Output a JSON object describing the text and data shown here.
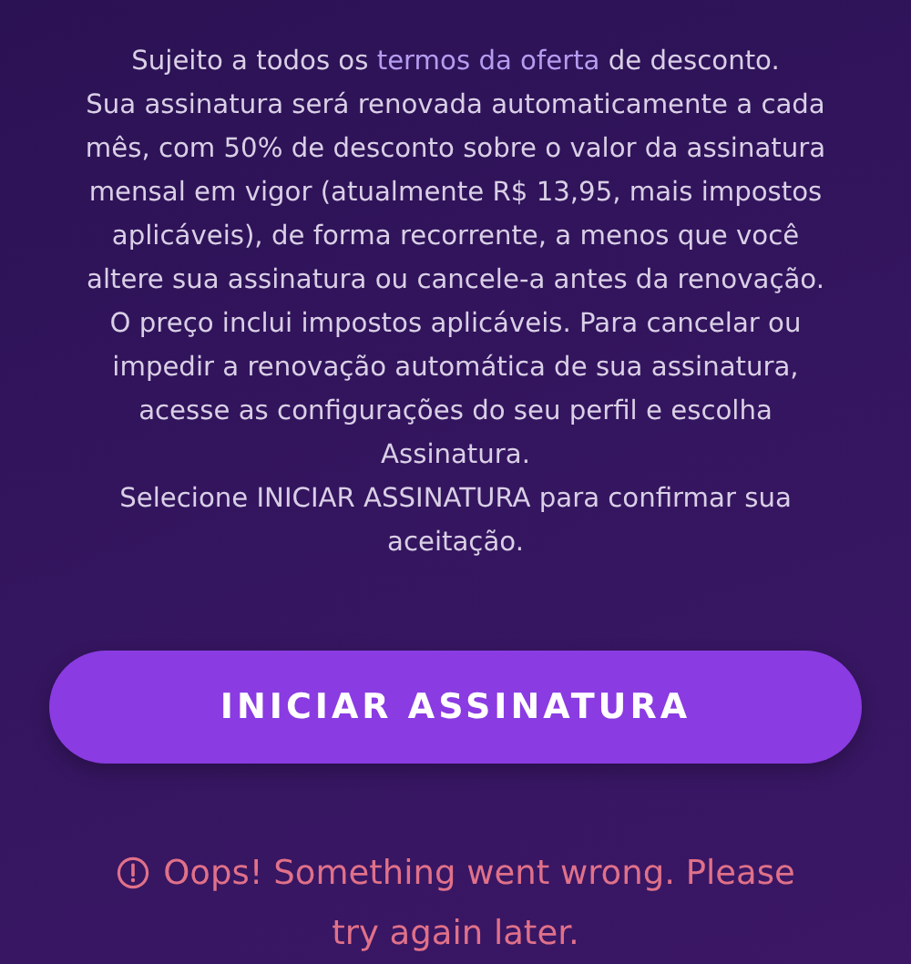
{
  "terms": {
    "before": "Sujeito a todos os ",
    "link": "termos da oferta",
    "after": " de desconto."
  },
  "renewal_text": "Sua assinatura será renovada automaticamente a cada mês, com 50% de desconto sobre o valor da assinatura mensal em vigor (atualmente R$ 13,95, mais impostos aplicáveis), de forma recorrente, a menos que você altere sua assinatura ou cancele-a antes da renovação. O preço inclui impostos aplicáveis. Para cancelar ou impedir a renovação automática de sua assinatura, acesse as configurações do seu perfil e escolha Assinatura.",
  "confirm_text": "Selecione INICIAR ASSINATURA para confirmar sua aceitação.",
  "button": "INICIAR ASSINATURA",
  "error": "Oops! Something went wrong. Please try again later."
}
